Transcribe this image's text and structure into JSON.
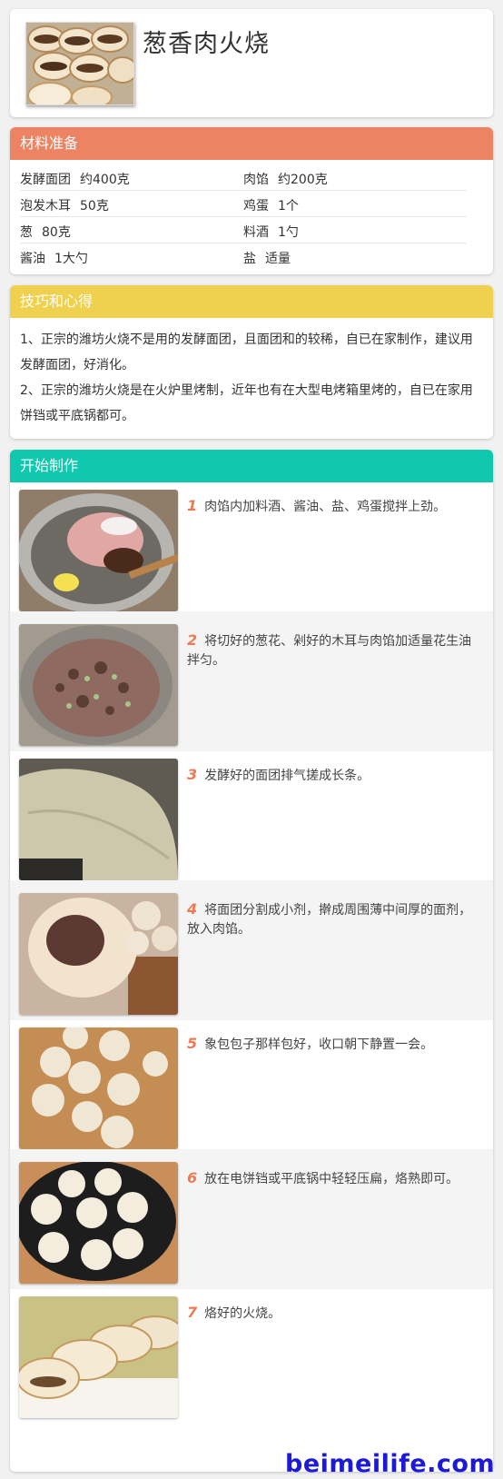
{
  "recipe": {
    "title": "葱香肉火烧",
    "thumb_image": "baked-meat-flatbread-photo"
  },
  "ingredients": {
    "heading": "材料准备",
    "rows": [
      [
        {
          "name": "发酵面团",
          "amount": "约400克"
        },
        {
          "name": "肉馅",
          "amount": "约200克"
        }
      ],
      [
        {
          "name": "泡发木耳",
          "amount": "50克"
        },
        {
          "name": "鸡蛋",
          "amount": "1个"
        }
      ],
      [
        {
          "name": "葱",
          "amount": "80克"
        },
        {
          "name": "料酒",
          "amount": "1勺"
        }
      ],
      [
        {
          "name": "酱油",
          "amount": "1大勺"
        },
        {
          "name": "盐",
          "amount": "适量"
        }
      ]
    ]
  },
  "tips": {
    "heading": "技巧和心得",
    "lines": [
      "1、正宗的潍坊火烧不是用的发酵面团，且面团和的较稀，自已在家制作，建议用发酵面团，好消化。",
      "2、正宗的潍坊火烧是在火炉里烤制，近年也有在大型电烤箱里烤的，自已在家用饼铛或平底锅都可。"
    ]
  },
  "steps": {
    "heading": "开始制作",
    "items": [
      {
        "num": "1",
        "text": "肉馅内加料酒、酱油、盐、鸡蛋搅拌上劲。",
        "image": "meat-egg-bowl-photo"
      },
      {
        "num": "2",
        "text": "将切好的葱花、剁好的木耳与肉馅加适量花生油拌匀。",
        "image": "mixed-filling-bowl-photo"
      },
      {
        "num": "3",
        "text": "发酵好的面团排气搓成长条。",
        "image": "dough-roll-photo"
      },
      {
        "num": "4",
        "text": "将面团分割成小剂，擀成周围薄中间厚的面剂，放入肉馅。",
        "image": "dough-wrapper-filling-photo"
      },
      {
        "num": "5",
        "text": "象包包子那样包好，收口朝下静置一会。",
        "image": "dough-balls-board-photo"
      },
      {
        "num": "6",
        "text": "放在电饼铛或平底锅中轻轻压扁，烙熟即可。",
        "image": "electric-pan-buns-photo"
      },
      {
        "num": "7",
        "text": "烙好的火烧。",
        "image": "finished-flatbread-plate-photo"
      }
    ]
  },
  "watermark": "beimeilife.com"
}
